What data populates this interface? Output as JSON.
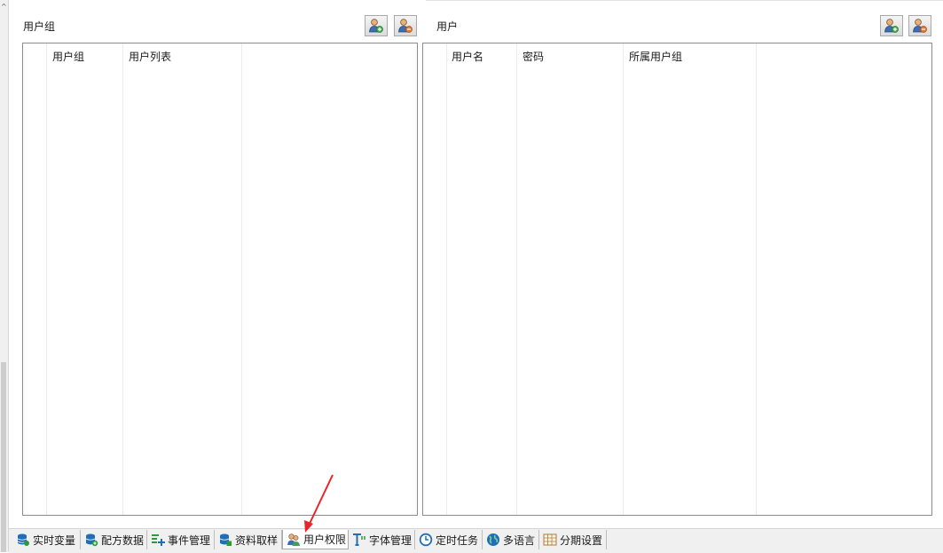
{
  "user_group_panel": {
    "title": "用户组",
    "columns": [
      "用户组",
      "用户列表"
    ],
    "buttons": [
      {
        "icon": "add-user-icon"
      },
      {
        "icon": "delete-user-icon"
      }
    ],
    "rows": []
  },
  "user_panel": {
    "title": "用户",
    "columns": [
      "用户名",
      "密码",
      "所属用户组"
    ],
    "buttons": [
      {
        "icon": "add-user-icon"
      },
      {
        "icon": "delete-user-icon"
      }
    ],
    "rows": []
  },
  "tabs": [
    {
      "label": "实时变量",
      "icon": "database-icon",
      "active": false
    },
    {
      "label": "配方数据",
      "icon": "database-add-icon",
      "active": false
    },
    {
      "label": "事件管理",
      "icon": "list-add-icon",
      "active": false
    },
    {
      "label": "资料取样",
      "icon": "database-sample-icon",
      "active": false
    },
    {
      "label": "用户权限",
      "icon": "users-icon",
      "active": true
    },
    {
      "label": "字体管理",
      "icon": "font-icon",
      "active": false
    },
    {
      "label": "定时任务",
      "icon": "clock-icon",
      "active": false
    },
    {
      "label": "多语言",
      "icon": "globe-icon",
      "active": false
    },
    {
      "label": "分期设置",
      "icon": "grid-table-icon",
      "active": false
    }
  ],
  "colors": {
    "annotation_arrow": "#e8242a",
    "tab_icon_blue": "#1e6fb8",
    "tab_icon_green": "#2a9a3a"
  }
}
